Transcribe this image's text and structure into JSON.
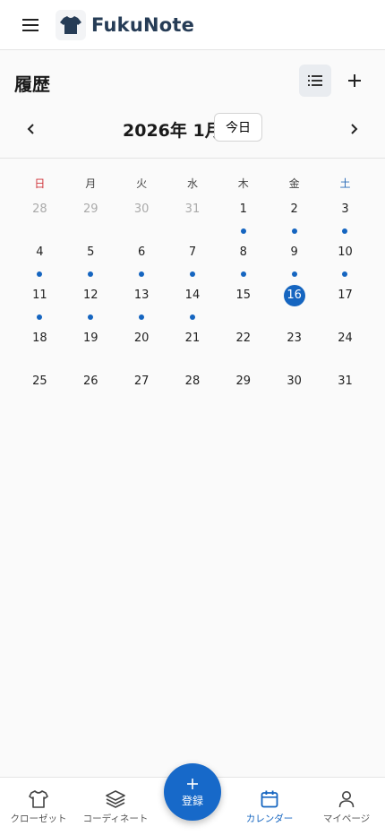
{
  "app": {
    "brand": "FukuNote"
  },
  "page": {
    "title": "履歴"
  },
  "month_nav": {
    "label": "2026年 1月",
    "today_button": "今日"
  },
  "calendar": {
    "weekdays": [
      "日",
      "月",
      "火",
      "水",
      "木",
      "金",
      "土"
    ],
    "weeks": [
      [
        {
          "d": "28",
          "m": true,
          "e": false
        },
        {
          "d": "29",
          "m": true,
          "e": false
        },
        {
          "d": "30",
          "m": true,
          "e": false
        },
        {
          "d": "31",
          "m": true,
          "e": false
        },
        {
          "d": "1",
          "m": false,
          "e": true
        },
        {
          "d": "2",
          "m": false,
          "e": true
        },
        {
          "d": "3",
          "m": false,
          "e": true
        }
      ],
      [
        {
          "d": "4",
          "m": false,
          "e": true
        },
        {
          "d": "5",
          "m": false,
          "e": true
        },
        {
          "d": "6",
          "m": false,
          "e": true
        },
        {
          "d": "7",
          "m": false,
          "e": true
        },
        {
          "d": "8",
          "m": false,
          "e": true
        },
        {
          "d": "9",
          "m": false,
          "e": true
        },
        {
          "d": "10",
          "m": false,
          "e": true
        }
      ],
      [
        {
          "d": "11",
          "m": false,
          "e": true
        },
        {
          "d": "12",
          "m": false,
          "e": true
        },
        {
          "d": "13",
          "m": false,
          "e": true
        },
        {
          "d": "14",
          "m": false,
          "e": true
        },
        {
          "d": "15",
          "m": false,
          "e": false
        },
        {
          "d": "16",
          "m": false,
          "e": false,
          "t": true
        },
        {
          "d": "17",
          "m": false,
          "e": false
        }
      ],
      [
        {
          "d": "18",
          "m": false,
          "e": false
        },
        {
          "d": "19",
          "m": false,
          "e": false
        },
        {
          "d": "20",
          "m": false,
          "e": false
        },
        {
          "d": "21",
          "m": false,
          "e": false
        },
        {
          "d": "22",
          "m": false,
          "e": false
        },
        {
          "d": "23",
          "m": false,
          "e": false
        },
        {
          "d": "24",
          "m": false,
          "e": false
        }
      ],
      [
        {
          "d": "25",
          "m": false,
          "e": false
        },
        {
          "d": "26",
          "m": false,
          "e": false
        },
        {
          "d": "27",
          "m": false,
          "e": false
        },
        {
          "d": "28",
          "m": false,
          "e": false
        },
        {
          "d": "29",
          "m": false,
          "e": false
        },
        {
          "d": "30",
          "m": false,
          "e": false
        },
        {
          "d": "31",
          "m": false,
          "e": false
        }
      ]
    ]
  },
  "bottom_nav": {
    "items": [
      {
        "label": "クローゼット",
        "icon": "shirt-icon",
        "active": false
      },
      {
        "label": "コーディネート",
        "icon": "layers-icon",
        "active": false
      },
      {
        "label": "カレンダー",
        "icon": "calendar-icon",
        "active": true
      },
      {
        "label": "マイページ",
        "icon": "user-icon",
        "active": false
      }
    ],
    "fab_label": "登録"
  },
  "colors": {
    "accent": "#1565c0",
    "brand_text": "#263c56",
    "sunday": "#d0343a",
    "saturday": "#2b6cb8"
  }
}
